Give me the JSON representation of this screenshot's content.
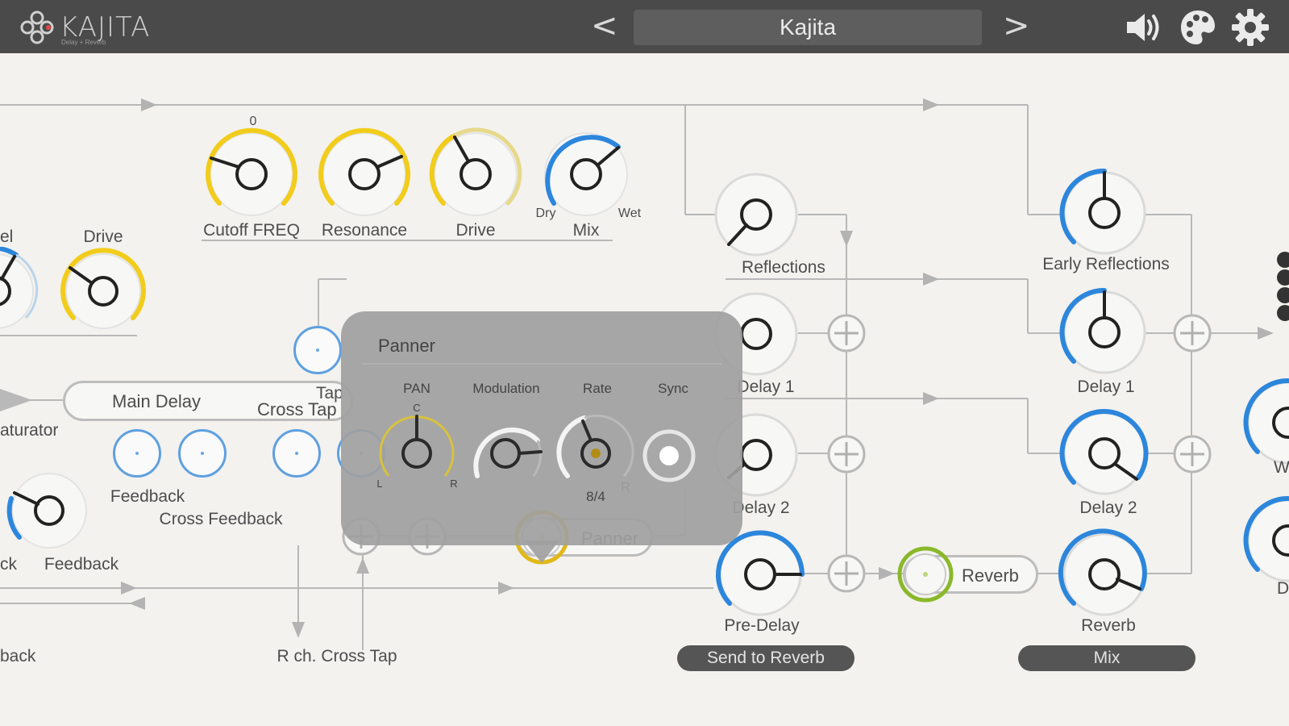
{
  "app": {
    "logo_text": "KAJITA",
    "logo_sub": "Delay + Reverb",
    "preset_name": "Kajita",
    "prev": "<",
    "next": ">",
    "icons": [
      "speaker-icon",
      "palette-icon",
      "gear-icon"
    ]
  },
  "filter": {
    "cutoff_top": "0",
    "cutoff": "Cutoff FREQ",
    "resonance": "Resonance",
    "drive": "Drive",
    "mix": "Mix",
    "dry": "Dry",
    "wet": "Wet"
  },
  "left": {
    "level_partial": "el",
    "drive": "Drive",
    "saturator": "aturator",
    "main_delay": "Main Delay",
    "cross_tap": "Cross Tap",
    "tap": "Tap",
    "feedback_small": "Feedback",
    "cross_feedback": "Cross Feedback",
    "back_partial": "ck",
    "feedback": "Feedback",
    "back2_partial": "back",
    "r_cross_tap": "R ch. Cross Tap",
    "r_label": "R"
  },
  "send": {
    "early_reflections": "Reflections",
    "delay1": "Delay 1",
    "delay2": "Delay 2",
    "pre_delay": "Pre-Delay",
    "send_to_reverb": "Send to Reverb",
    "panner": "Panner",
    "reverb_pill": "Reverb"
  },
  "mix": {
    "early_reflections": "Early Reflections",
    "delay1": "Delay 1",
    "delay2": "Delay 2",
    "reverb": "Reverb",
    "mix_button": "Mix",
    "w_partial": "W",
    "d_partial": "D"
  },
  "panner_popup": {
    "title": "Panner",
    "pan": "PAN",
    "modulation": "Modulation",
    "rate": "Rate",
    "sync": "Sync",
    "pan_c": "C",
    "pan_l": "L",
    "pan_r": "R",
    "rate_value": "8/4"
  },
  "colors": {
    "topbar": "#4a4a4a",
    "background": "#f3f2ef",
    "yellow_arc": "#f2cc1b",
    "blue_arc": "#2c86dc",
    "green_ring": "#8ab82a",
    "popup": "#a0a0a0"
  }
}
